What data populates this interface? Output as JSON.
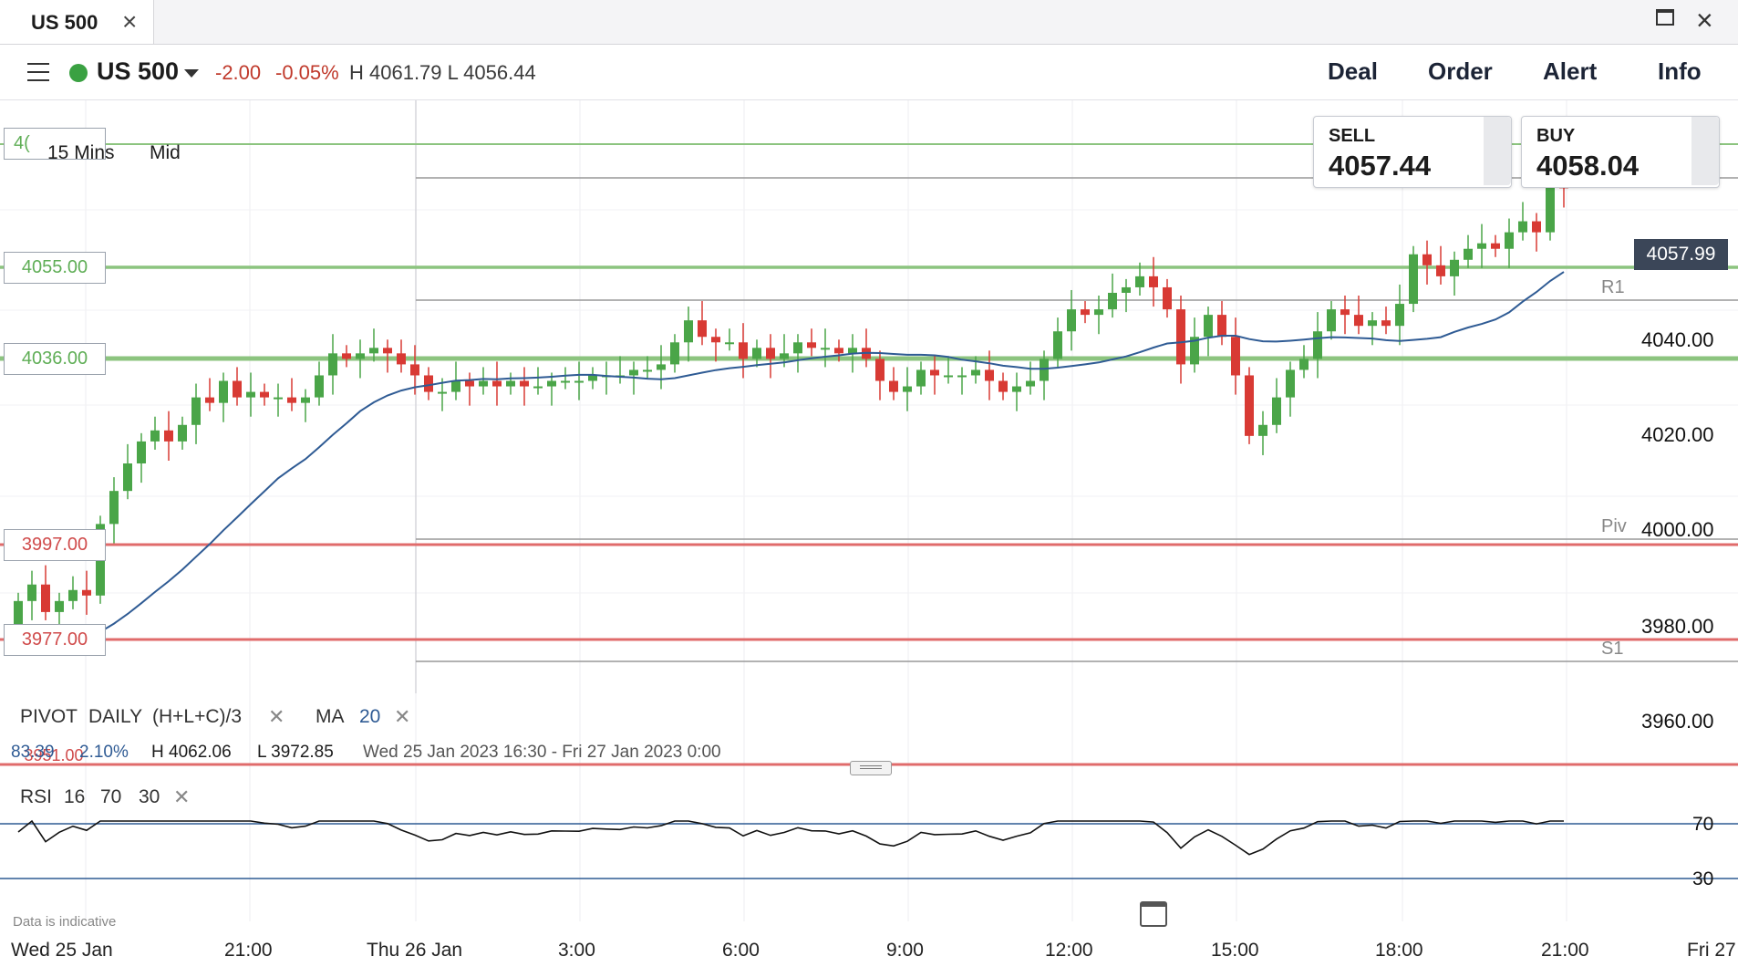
{
  "tab": {
    "title": "US 500"
  },
  "header": {
    "instrument": "US 500",
    "change_abs": "-2.00",
    "change_pct": "-0.05%",
    "high_low": "H 4061.79  L 4056.44",
    "nav": [
      "Deal",
      "Order",
      "Alert",
      "Info"
    ]
  },
  "chart_controls": {
    "interval": "15 Mins",
    "price_type": "Mid",
    "top_level_partial": "4("
  },
  "prices": {
    "sell_label": "SELL",
    "sell": "4057.44",
    "buy_label": "BUY",
    "buy": "4058.04",
    "last": "4057.99"
  },
  "levels": {
    "l4055": "4055.00",
    "l4036": "4036.00",
    "l3997": "3997.00",
    "l3977": "3977.00",
    "l_hidden": "3951.00"
  },
  "pivot_labels": {
    "r1": "R1",
    "piv": "Piv",
    "s1": "S1"
  },
  "indicators": {
    "pivot": {
      "name": "PIVOT",
      "period": "DAILY",
      "formula": "(H+L+C)/3"
    },
    "ma": {
      "name": "MA",
      "period": "20"
    },
    "rsi": {
      "name": "RSI",
      "period": "16",
      "upper": "70",
      "lower": "30"
    }
  },
  "stats": {
    "range": "83.39",
    "range_pct": "2.10%",
    "high": "H 4062.06",
    "low": "L 3972.85",
    "period": "Wed 25 Jan 2023 16:30 - Fri 27 Jan 2023 0:00"
  },
  "footer": {
    "disclaimer": "Data is indicative"
  },
  "chart_data": {
    "type": "candlestick",
    "y_ticks": [
      "4040.00",
      "4020.00",
      "4000.00",
      "3980.00",
      "3960.00"
    ],
    "x_ticks": [
      "Wed 25 Jan",
      "21:00",
      "Thu 26 Jan",
      "3:00",
      "6:00",
      "9:00",
      "12:00",
      "15:00",
      "18:00",
      "21:00",
      "Fri 27"
    ],
    "rsi_ticks": [
      "70",
      "30"
    ],
    "ylim": [
      3953,
      4071
    ],
    "closes": [
      3985,
      3988,
      3983,
      3985,
      3987,
      3986,
      3999,
      4005,
      4010,
      4014,
      4016,
      4014,
      4017,
      4022,
      4021,
      4025,
      4022,
      4023,
      4022,
      4022,
      4021,
      4022,
      4026,
      4030,
      4029,
      4030,
      4031,
      4030,
      4028,
      4026,
      4023,
      4023,
      4025,
      4024,
      4025,
      4024,
      4025,
      4024,
      4024,
      4025,
      4025,
      4025,
      4026,
      4026,
      4026,
      4027,
      4027,
      4028,
      4032,
      4036,
      4033,
      4032,
      4032,
      4029,
      4031,
      4029,
      4030,
      4032,
      4031,
      4031,
      4030,
      4031,
      4029,
      4025,
      4023,
      4024,
      4027,
      4026,
      4026,
      4026,
      4027,
      4025,
      4023,
      4024,
      4025,
      4029,
      4034,
      4038,
      4037,
      4038,
      4041,
      4042,
      4044,
      4042,
      4038,
      4028,
      4033,
      4037,
      4033,
      4026,
      4015,
      4017,
      4022,
      4027,
      4029,
      4034,
      4038,
      4037,
      4035,
      4036,
      4035,
      4039,
      4048,
      4046,
      4044,
      4047,
      4049,
      4050,
      4049,
      4052,
      4054,
      4052,
      4062,
      4060
    ]
  }
}
